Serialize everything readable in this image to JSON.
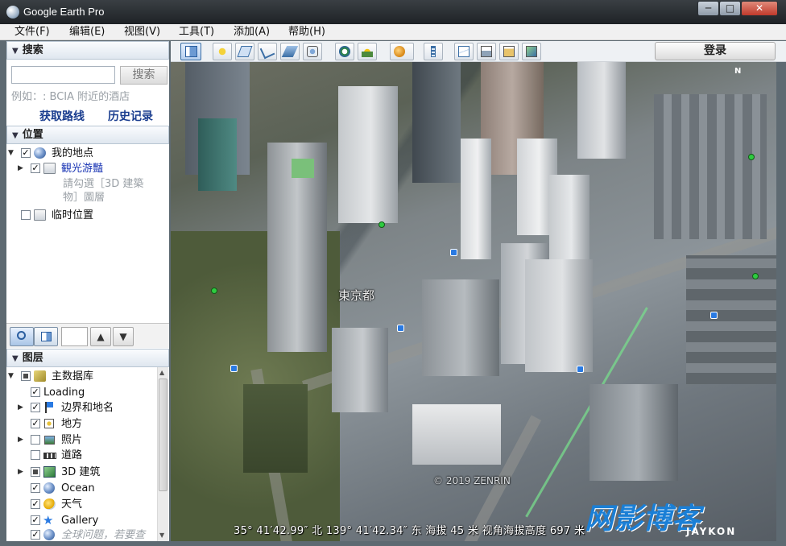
{
  "window": {
    "title": "Google Earth Pro",
    "min_label": "─",
    "max_label": "□",
    "close_label": "✕"
  },
  "menu": [
    {
      "label": "文件(F)"
    },
    {
      "label": "编辑(E)"
    },
    {
      "label": "视图(V)"
    },
    {
      "label": "工具(T)"
    },
    {
      "label": "添加(A)"
    },
    {
      "label": "帮助(H)"
    }
  ],
  "search": {
    "header": "搜索",
    "input_value": "",
    "button": "搜索",
    "hint": "例如：: BCIA 附近的酒店",
    "get_directions": "获取路线",
    "history": "历史记录"
  },
  "places": {
    "header": "位置",
    "items": [
      {
        "label": "我的地点",
        "checked": true
      },
      {
        "label": "観光游豔",
        "checked": true
      },
      {
        "label": "請勾選［3D 建築"
      },
      {
        "label": "物］圖層"
      },
      {
        "label": "临时位置",
        "checked": false
      }
    ]
  },
  "layers": {
    "header": "图层",
    "items": [
      {
        "label": "主数据库"
      },
      {
        "label": "Loading"
      },
      {
        "label": "边界和地名"
      },
      {
        "label": "地方"
      },
      {
        "label": "照片"
      },
      {
        "label": "道路"
      },
      {
        "label": "3D 建筑"
      },
      {
        "label": "Ocean"
      },
      {
        "label": "天气"
      },
      {
        "label": "Gallery"
      },
      {
        "label": "全球问题，若要查"
      }
    ]
  },
  "toolbar": {
    "login": "登录"
  },
  "view": {
    "place_label": "東京都",
    "copyright": "© 2019 ZENRIN",
    "status_lat": "35° 41′42.99″ 北",
    "status_lon": "139° 41′42.34″ 东",
    "status_elev_label": "海拔",
    "status_elev": "45 米",
    "status_eye_label": "视角海拔高度",
    "status_eye": "697 米",
    "compass": "N",
    "watermark": "网影博客",
    "watermark_sub": "JAYKON"
  }
}
